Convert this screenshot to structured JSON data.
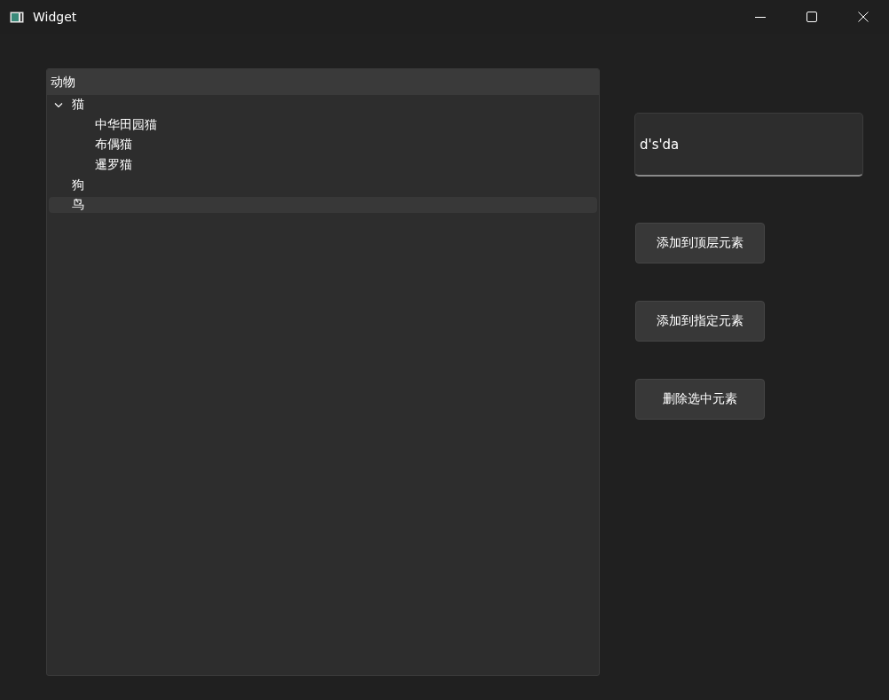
{
  "window": {
    "title": "Widget"
  },
  "tree": {
    "header": "动物",
    "items": [
      {
        "label": "猫",
        "selected": false,
        "expanded": true,
        "children": [
          {
            "label": "中华田园猫",
            "selected": false
          },
          {
            "label": "布偶猫",
            "selected": false
          },
          {
            "label": "暹罗猫",
            "selected": false
          }
        ]
      },
      {
        "label": "狗",
        "selected": false
      },
      {
        "label": "鸟",
        "selected": true
      }
    ]
  },
  "input": {
    "value": "d's'da"
  },
  "buttons": [
    "添加到顶层元素",
    "添加到指定元素",
    "删除选中元素"
  ]
}
